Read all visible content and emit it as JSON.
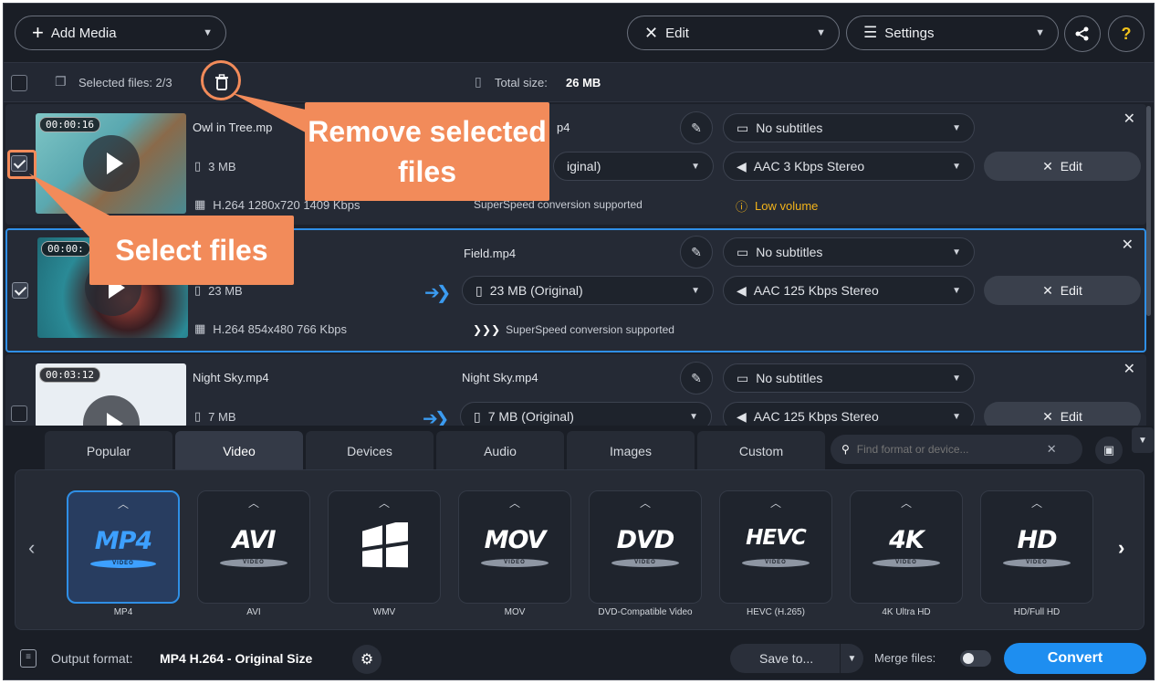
{
  "toolbar": {
    "add_media": "Add Media",
    "edit": "Edit",
    "settings": "Settings",
    "share_icon": "share-icon",
    "help": "?"
  },
  "selection": {
    "selected_files": "Selected files: 2/3",
    "total_size_label": "Total size:",
    "total_size_value": "26 MB"
  },
  "files": [
    {
      "duration": "00:00:16",
      "name": "Owl in Tree.mp4",
      "name_visible": "Owl in Tree.mp",
      "size": "3 MB",
      "codec": "H.264 1280x720 1409 Kbps",
      "output_name": "Owl in Tree.mp4",
      "output_name_visible": "p4",
      "output_size": "3 MB (Original)",
      "output_size_visible": "iginal)",
      "subtitles": "No subtitles",
      "audio": "AAC 3 Kbps Stereo",
      "speed": "SuperSpeed conversion supported",
      "warning": "Low volume",
      "edit": "Edit",
      "checked": true
    },
    {
      "duration": "00:00:",
      "name": "Field.mp4",
      "size": "23 MB",
      "codec": "H.264 854x480 766 Kbps",
      "output_name": "Field.mp4",
      "output_size": "23 MB (Original)",
      "subtitles": "No subtitles",
      "audio": "AAC 125 Kbps Stereo",
      "speed": "SuperSpeed conversion supported",
      "edit": "Edit",
      "checked": true
    },
    {
      "duration": "00:03:12",
      "name": "Night Sky.mp4",
      "size": "7 MB",
      "output_name": "Night Sky.mp4",
      "output_size": "7 MB (Original)",
      "subtitles": "No subtitles",
      "audio": "AAC 125 Kbps Stereo",
      "edit": "Edit",
      "checked": false
    }
  ],
  "tabs": [
    "Popular",
    "Video",
    "Devices",
    "Audio",
    "Images",
    "Custom"
  ],
  "active_tab": "Video",
  "search": {
    "placeholder": "Find format or device..."
  },
  "formats": [
    {
      "logo": "MP4",
      "sub": "VIDEO",
      "label": "MP4",
      "active": true
    },
    {
      "logo": "AVI",
      "sub": "VIDEO",
      "label": "AVI"
    },
    {
      "logo": "",
      "sub": "",
      "label": "WMV"
    },
    {
      "logo": "MOV",
      "sub": "VIDEO",
      "label": "MOV"
    },
    {
      "logo": "DVD",
      "sub": "VIDEO",
      "label": "DVD-Compatible Video"
    },
    {
      "logo": "HEVC",
      "sub": "VIDEO",
      "label": "HEVC (H.265)"
    },
    {
      "logo": "4K",
      "sub": "VIDEO",
      "label": "4K Ultra HD"
    },
    {
      "logo": "HD",
      "sub": "VIDEO",
      "label": "HD/Full HD"
    }
  ],
  "footer": {
    "output_label": "Output format:",
    "output_value": "MP4 H.264 - Original Size",
    "save_to": "Save to...",
    "merge_files": "Merge files:",
    "convert": "Convert"
  },
  "callouts": {
    "remove": "Remove selected files",
    "select": "Select files"
  },
  "colors": {
    "accent": "#2f8fe6",
    "callout": "#f28b5a",
    "warning": "#f2b31a",
    "background": "#1d212a"
  }
}
